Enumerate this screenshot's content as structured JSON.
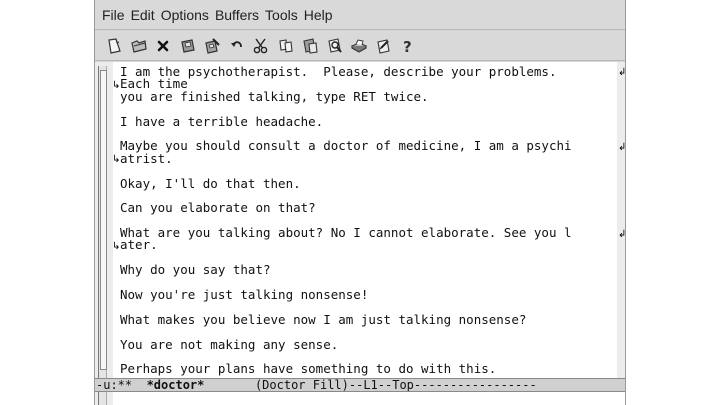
{
  "menubar": {
    "items": [
      "File",
      "Edit",
      "Options",
      "Buffers",
      "Tools",
      "Help"
    ]
  },
  "toolbar": {
    "tools": [
      {
        "name": "new-file-icon"
      },
      {
        "name": "open-folder-icon"
      },
      {
        "name": "close-buffer-icon"
      },
      {
        "name": "save-icon"
      },
      {
        "name": "save-as-icon"
      },
      {
        "name": "undo-icon"
      },
      {
        "name": "cut-icon"
      },
      {
        "name": "copy-icon"
      },
      {
        "name": "paste-icon"
      },
      {
        "name": "search-icon"
      },
      {
        "name": "print-icon"
      },
      {
        "name": "preferences-icon"
      },
      {
        "name": "help-icon"
      }
    ]
  },
  "buffer": {
    "lines": [
      "I am the psychotherapist.  Please, describe your problems.",
      "Each time",
      "you are finished talking, type RET twice.",
      "",
      "I have a terrible headache.",
      "",
      "Maybe you should consult a doctor of medicine, I am a psychi",
      "atrist.",
      "",
      "Okay, I'll do that then.",
      "",
      "Can you elaborate on that?",
      "",
      "What are you talking about? No I cannot elaborate. See you l",
      "ater.",
      "",
      "Why do you say that?",
      "",
      "Now you're just talking nonsense!",
      "",
      "What makes you believe now I am just talking nonsense?",
      "",
      "You are not making any sense.",
      "",
      "Perhaps your plans have something to do with this."
    ]
  },
  "modeline": {
    "prefix": "-u:**  ",
    "buffer_name": "*doctor*",
    "middle": "       (Doctor Fill)--L1--Top",
    "tail": "-----------------"
  }
}
